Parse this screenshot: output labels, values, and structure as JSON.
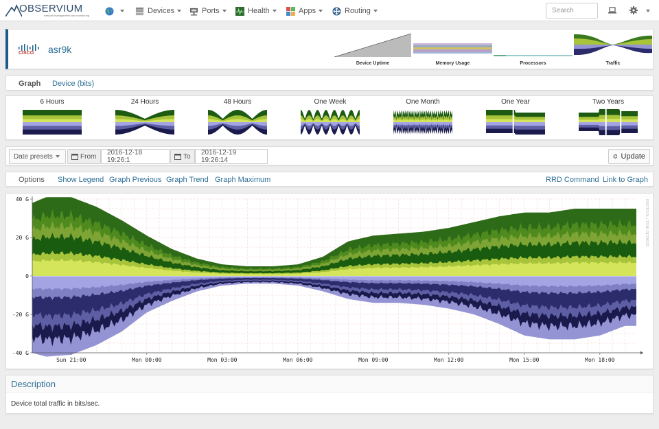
{
  "nav": {
    "logo_word": "OBSERVIUM",
    "logo_sub": "network management and monitoring",
    "items": [
      {
        "label": "",
        "icon": "globe-icon"
      },
      {
        "label": "Devices",
        "icon": "server-icon"
      },
      {
        "label": "Ports",
        "icon": "network-port-icon"
      },
      {
        "label": "Health",
        "icon": "heartbeat-icon"
      },
      {
        "label": "Apps",
        "icon": "apps-grid-icon"
      },
      {
        "label": "Routing",
        "icon": "routing-icon"
      }
    ],
    "search_placeholder": "Search"
  },
  "device": {
    "vendor_logo": "CISCO",
    "name": "asr9k",
    "thumbs": [
      "Device Uptime",
      "Memory Usage",
      "Processors",
      "Traffic"
    ]
  },
  "tabs": {
    "graph": "Graph",
    "device_bits": "Device (bits)"
  },
  "periods": [
    "6 Hours",
    "24 Hours",
    "48 Hours",
    "One Week",
    "One Month",
    "One Year",
    "Two Years"
  ],
  "datebar": {
    "presets": "Date presets",
    "from_label": "From",
    "from_value": "2016-12-18 19:26:1",
    "to_label": "To",
    "to_value": "2016-12-19 19:26:14",
    "update": "Update"
  },
  "options": {
    "options": "Options",
    "show_legend": "Show Legend",
    "graph_previous": "Graph Previous",
    "graph_trend": "Graph Trend",
    "graph_maximum": "Graph Maximum",
    "rrd_command": "RRD Command",
    "link_to_graph": "Link to Graph"
  },
  "chart_data": {
    "type": "area",
    "title": "",
    "ylabel": "",
    "watermark": "RRDTOOL / TOBI OETIKER",
    "ylim": [
      -40,
      40
    ],
    "y_ticks": [
      "40 G",
      "20 G",
      "0",
      "-20 G",
      "-40 G"
    ],
    "y_tick_values": [
      40,
      20,
      0,
      -20,
      -40
    ],
    "x_ticks": [
      "Sun 21:00",
      "Mon 00:00",
      "Mon 03:00",
      "Mon 06:00",
      "Mon 09:00",
      "Mon 12:00",
      "Mon 15:00",
      "Mon 18:00"
    ],
    "x_hours": [
      19.45,
      20,
      21,
      22,
      23,
      24,
      25,
      26,
      27,
      28,
      29,
      30,
      31,
      32,
      33,
      34,
      35,
      36,
      37,
      38,
      39,
      40,
      41,
      42,
      43,
      43.45
    ],
    "in_total_gbps": [
      38,
      41,
      41,
      36,
      29,
      21,
      14,
      9,
      6,
      5,
      5,
      6,
      10,
      18,
      21,
      22,
      23,
      25,
      28,
      31,
      33,
      33,
      35,
      35,
      35,
      35
    ],
    "out_total_gbps": [
      -40,
      -42,
      -41,
      -36,
      -29,
      -19,
      -13,
      -8,
      -5,
      -4,
      -4,
      -5,
      -8,
      -12,
      -14,
      -14,
      -15,
      -17,
      -20,
      -25,
      -31,
      -33,
      -33,
      -31,
      -26,
      -26
    ],
    "in_colors": [
      "#d4e55c",
      "#a8c43a",
      "#195b0f",
      "#7da434",
      "#4f8a1f",
      "#2e6b18"
    ],
    "out_colors": [
      "#a4a4e4",
      "#7f7fc4",
      "#2c2c6c",
      "#5e5ea4",
      "#1a1a4c",
      "#9494d4"
    ],
    "grid": true
  },
  "description": {
    "title": "Description",
    "text": "Device total traffic in bits/sec."
  }
}
